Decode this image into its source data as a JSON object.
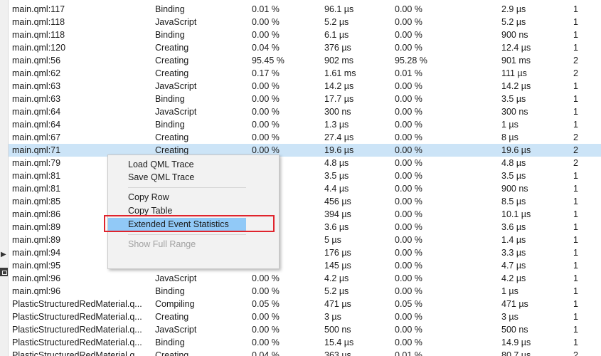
{
  "rows": [
    {
      "location": "main.qml:117",
      "type": "Binding",
      "time_pct": "0.01 %",
      "total": "96.1 µs",
      "self_pct": "0.00 %",
      "mean": "2.9 µs",
      "calls": "1"
    },
    {
      "location": "main.qml:118",
      "type": "JavaScript",
      "time_pct": "0.00 %",
      "total": "5.2 µs",
      "self_pct": "0.00 %",
      "mean": "5.2 µs",
      "calls": "1"
    },
    {
      "location": "main.qml:118",
      "type": "Binding",
      "time_pct": "0.00 %",
      "total": "6.1 µs",
      "self_pct": "0.00 %",
      "mean": "900 ns",
      "calls": "1"
    },
    {
      "location": "main.qml:120",
      "type": "Creating",
      "time_pct": "0.04 %",
      "total": "376 µs",
      "self_pct": "0.00 %",
      "mean": "12.4 µs",
      "calls": "1"
    },
    {
      "location": "main.qml:56",
      "type": "Creating",
      "time_pct": "95.45 %",
      "total": "902 ms",
      "self_pct": "95.28 %",
      "mean": "901 ms",
      "calls": "2"
    },
    {
      "location": "main.qml:62",
      "type": "Creating",
      "time_pct": "0.17 %",
      "total": "1.61 ms",
      "self_pct": "0.01 %",
      "mean": "111 µs",
      "calls": "2"
    },
    {
      "location": "main.qml:63",
      "type": "JavaScript",
      "time_pct": "0.00 %",
      "total": "14.2 µs",
      "self_pct": "0.00 %",
      "mean": "14.2 µs",
      "calls": "1"
    },
    {
      "location": "main.qml:63",
      "type": "Binding",
      "time_pct": "0.00 %",
      "total": "17.7 µs",
      "self_pct": "0.00 %",
      "mean": "3.5 µs",
      "calls": "1"
    },
    {
      "location": "main.qml:64",
      "type": "JavaScript",
      "time_pct": "0.00 %",
      "total": "300 ns",
      "self_pct": "0.00 %",
      "mean": "300 ns",
      "calls": "1"
    },
    {
      "location": "main.qml:64",
      "type": "Binding",
      "time_pct": "0.00 %",
      "total": "1.3 µs",
      "self_pct": "0.00 %",
      "mean": "1 µs",
      "calls": "1"
    },
    {
      "location": "main.qml:67",
      "type": "Creating",
      "time_pct": "0.00 %",
      "total": "27.4 µs",
      "self_pct": "0.00 %",
      "mean": "8 µs",
      "calls": "2"
    },
    {
      "location": "main.qml:71",
      "type": "Creating",
      "time_pct": "0.00 %",
      "total": "19.6 µs",
      "self_pct": "0.00 %",
      "mean": "19.6 µs",
      "calls": "2",
      "selected": true
    },
    {
      "location": "main.qml:79",
      "type": "",
      "time_pct": "",
      "total": "4.8 µs",
      "self_pct": "0.00 %",
      "mean": "4.8 µs",
      "calls": "2"
    },
    {
      "location": "main.qml:81",
      "type": "",
      "time_pct": "",
      "total": "3.5 µs",
      "self_pct": "0.00 %",
      "mean": "3.5 µs",
      "calls": "1"
    },
    {
      "location": "main.qml:81",
      "type": "",
      "time_pct": "",
      "total": "4.4 µs",
      "self_pct": "0.00 %",
      "mean": "900 ns",
      "calls": "1"
    },
    {
      "location": "main.qml:85",
      "type": "",
      "time_pct": "",
      "total": "456 µs",
      "self_pct": "0.00 %",
      "mean": "8.5 µs",
      "calls": "1"
    },
    {
      "location": "main.qml:86",
      "type": "",
      "time_pct": "",
      "total": "394 µs",
      "self_pct": "0.00 %",
      "mean": "10.1 µs",
      "calls": "1"
    },
    {
      "location": "main.qml:89",
      "type": "",
      "time_pct": "",
      "total": "3.6 µs",
      "self_pct": "0.00 %",
      "mean": "3.6 µs",
      "calls": "1"
    },
    {
      "location": "main.qml:89",
      "type": "",
      "time_pct": "",
      "total": "5 µs",
      "self_pct": "0.00 %",
      "mean": "1.4 µs",
      "calls": "1"
    },
    {
      "location": "main.qml:94",
      "type": "",
      "time_pct": "",
      "total": "176 µs",
      "self_pct": "0.00 %",
      "mean": "3.3 µs",
      "calls": "1"
    },
    {
      "location": "main.qml:95",
      "type": "",
      "time_pct": "",
      "total": "145 µs",
      "self_pct": "0.00 %",
      "mean": "4.7 µs",
      "calls": "1"
    },
    {
      "location": "main.qml:96",
      "type": "JavaScript",
      "time_pct": "0.00 %",
      "total": "4.2 µs",
      "self_pct": "0.00 %",
      "mean": "4.2 µs",
      "calls": "1"
    },
    {
      "location": "main.qml:96",
      "type": "Binding",
      "time_pct": "0.00 %",
      "total": "5.2 µs",
      "self_pct": "0.00 %",
      "mean": "1 µs",
      "calls": "1"
    },
    {
      "location": "PlasticStructuredRedMaterial.q...",
      "type": "Compiling",
      "time_pct": "0.05 %",
      "total": "471 µs",
      "self_pct": "0.05 %",
      "mean": "471 µs",
      "calls": "1"
    },
    {
      "location": "PlasticStructuredRedMaterial.q...",
      "type": "Creating",
      "time_pct": "0.00 %",
      "total": "3 µs",
      "self_pct": "0.00 %",
      "mean": "3 µs",
      "calls": "1"
    },
    {
      "location": "PlasticStructuredRedMaterial.q...",
      "type": "JavaScript",
      "time_pct": "0.00 %",
      "total": "500 ns",
      "self_pct": "0.00 %",
      "mean": "500 ns",
      "calls": "1"
    },
    {
      "location": "PlasticStructuredRedMaterial.q...",
      "type": "Binding",
      "time_pct": "0.00 %",
      "total": "15.4 µs",
      "self_pct": "0.00 %",
      "mean": "14.9 µs",
      "calls": "1"
    },
    {
      "location": "PlasticStructuredRedMaterial.q...",
      "type": "Creating",
      "time_pct": "0.04 %",
      "total": "363 µs",
      "self_pct": "0.01 %",
      "mean": "80.7 µs",
      "calls": "2"
    }
  ],
  "context_menu": {
    "load_trace": "Load QML Trace",
    "save_trace": "Save QML Trace",
    "copy_row": "Copy Row",
    "copy_table": "Copy Table",
    "extended_stats": "Extended Event Statistics",
    "show_full_range": "Show Full Range"
  },
  "colors": {
    "selected_row": "#cce4f7",
    "menu_hover": "#91c9f7",
    "highlight_border": "#e0242d"
  },
  "gutter": {
    "arrow_icon": "chevron-right-icon",
    "panel_icon": "panel-icon"
  }
}
